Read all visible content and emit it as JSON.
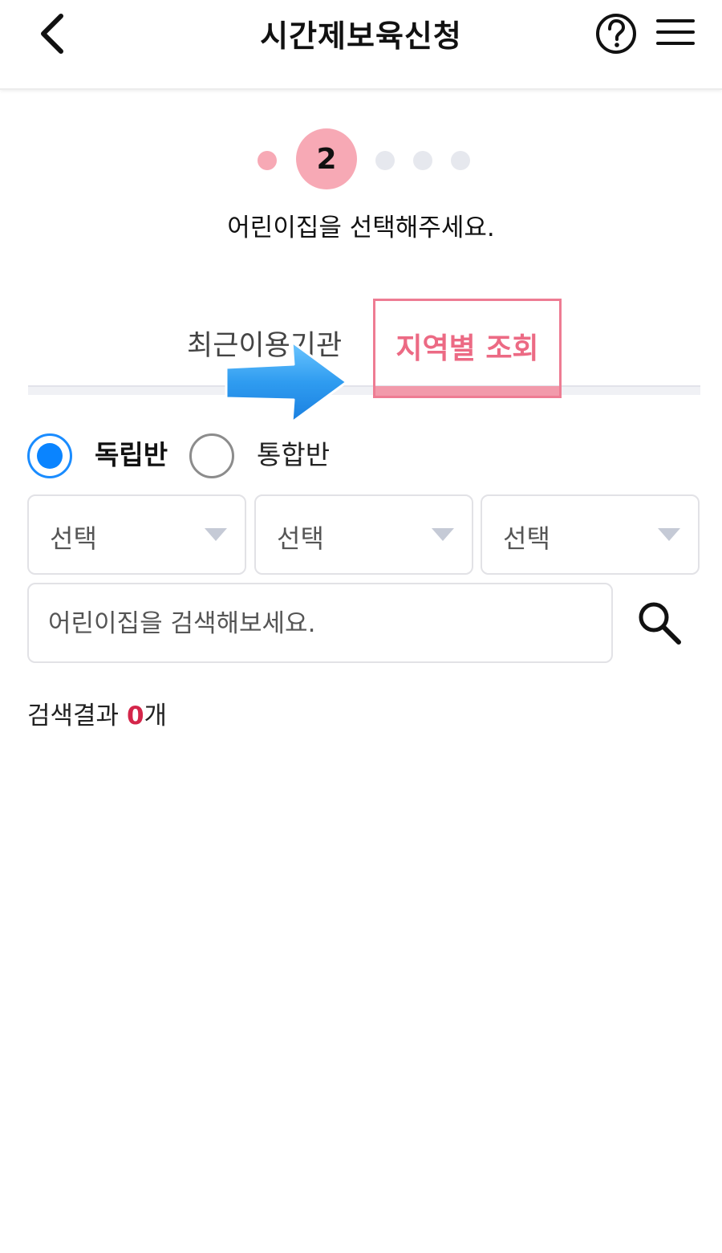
{
  "header": {
    "title": "시간제보육신청",
    "back_icon": "chevron-left-icon",
    "help_icon": "question-circle-icon",
    "menu_icon": "hamburger-menu-icon"
  },
  "steps": {
    "current_label": "2",
    "current": 2,
    "total": 5
  },
  "instruction": "어린이집을 선택해주세요.",
  "tabs": {
    "recent_label": "최근이용기관",
    "region_label": "지역별 조회",
    "active": "region",
    "active_color": "#ec6a84"
  },
  "class_type": {
    "options": [
      "독립반",
      "통합반"
    ],
    "selected": "독립반",
    "radio_color": "#0a84ff"
  },
  "selects": [
    {
      "value": "선택"
    },
    {
      "value": "선택"
    },
    {
      "value": "선택"
    }
  ],
  "search": {
    "placeholder": "어린이집을 검색해보세요.",
    "value": "",
    "icon": "search-icon"
  },
  "result": {
    "prefix": "검색결과 ",
    "count": "0",
    "suffix": "개",
    "count_color": "#d4264a"
  },
  "annotation": {
    "icon": "arrow-right-icon",
    "color": "#2f9cf0"
  }
}
